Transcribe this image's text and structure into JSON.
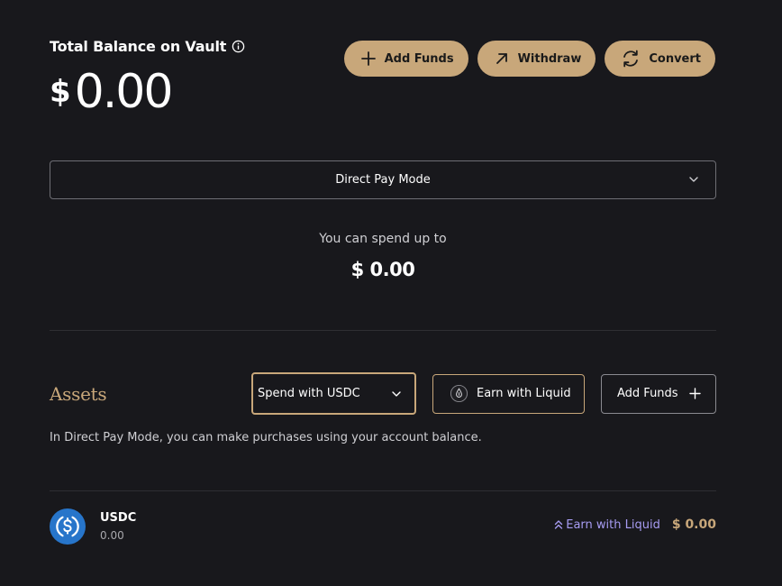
{
  "balance": {
    "title": "Total Balance on Vault",
    "info_icon": "info-circle-icon",
    "currency_symbol": "$",
    "amount": "0.00"
  },
  "actions": {
    "add_funds": {
      "label": "Add Funds",
      "icon": "plus-icon"
    },
    "withdraw": {
      "label": "Withdraw",
      "icon": "arrow-up-right-icon"
    },
    "convert": {
      "label": "Convert",
      "icon": "refresh-icon"
    }
  },
  "mode": {
    "selected": "Direct Pay Mode",
    "icon": "chevron-down-icon"
  },
  "spend": {
    "label": "You can spend up to",
    "value": "$ 0.00"
  },
  "assets": {
    "title": "Assets",
    "spend_select": {
      "selected": "Spend with USDC",
      "icon": "chevron-down-icon"
    },
    "earn_button": {
      "label": "Earn with Liquid",
      "icon": "liquid-drop-icon"
    },
    "add_funds_button": {
      "label": "Add Funds",
      "icon": "plus-icon"
    },
    "note": "In Direct Pay Mode, you can make purchases using your account balance.",
    "items": [
      {
        "name": "USDC",
        "amount": "0.00",
        "icon": "usdc-coin-icon",
        "earn_link": "Earn with Liquid",
        "earn_icon": "double-chevron-up-icon",
        "value": "$ 0.00"
      }
    ]
  },
  "colors": {
    "background": "#18181c",
    "accent_gold": "#c8a77a",
    "link_purple": "#a79cf2",
    "usdc_blue": "#2775ca"
  }
}
